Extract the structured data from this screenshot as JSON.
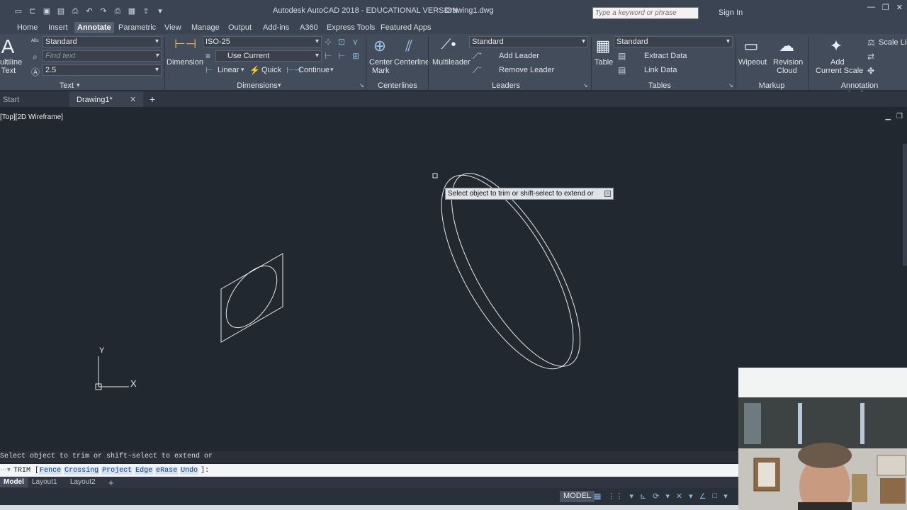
{
  "app": {
    "title": "Autodesk AutoCAD 2018 - EDUCATIONAL VERSION",
    "file": "Drawing1.dwg",
    "search_placeholder": "Type a keyword or phrase",
    "sign_in": "Sign In"
  },
  "menu_tabs": [
    "Home",
    "Insert",
    "Annotate",
    "Parametric",
    "View",
    "Manage",
    "Output",
    "Add-ins",
    "A360",
    "Express Tools",
    "Featured Apps"
  ],
  "active_tab": "Annotate",
  "ribbon": {
    "text_panel": {
      "title": "Text",
      "multiline_label_1": "ultiline",
      "multiline_label_2": "Text",
      "style_value": "Standard",
      "find_placeholder": "Find text",
      "height_value": "2.5"
    },
    "dimensions_panel": {
      "title": "Dimensions",
      "dimension_label": "Dimension",
      "style_value": "ISO-25",
      "layer_value": "Use Current",
      "linear_label": "Linear",
      "quick_label": "Quick",
      "continue_label": "Continue"
    },
    "centerlines_panel": {
      "title": "Centerlines",
      "center_mark_1": "Center",
      "center_mark_2": "Mark",
      "centerline_label": "Centerline"
    },
    "leaders_panel": {
      "title": "Leaders",
      "multileader_label": "Multileader",
      "style_value": "Standard",
      "add_leader": "Add Leader",
      "remove_leader": "Remove Leader"
    },
    "tables_panel": {
      "title": "Tables",
      "table_label": "Table",
      "style_value": "Standard",
      "extract_data": "Extract Data",
      "link_data": "Link Data"
    },
    "markup_panel": {
      "title": "Markup",
      "wipeout": "Wipeout",
      "revision_1": "Revision",
      "revision_2": "Cloud"
    },
    "annotation_scaling_panel": {
      "title": "Annotation Scaling",
      "add_scale_1": "Add",
      "add_scale_2": "Current Scale",
      "scale_list": "Scale List"
    }
  },
  "file_tabs": {
    "start": "Start",
    "drawing": "Drawing1*"
  },
  "viewport": {
    "label": "[Top][2D Wireframe]",
    "ucs_x": "X",
    "ucs_y": "Y"
  },
  "tooltip": {
    "text": "Select object to trim or shift-select to extend or"
  },
  "command": {
    "history": "Select object to trim or shift-select to extend or",
    "name": "TRIM",
    "options": [
      "Fence",
      "Crossing",
      "Project",
      "Edge",
      "eRase",
      "Undo"
    ],
    "suffix": "]:"
  },
  "layout_tabs": [
    "Model",
    "Layout1",
    "Layout2"
  ],
  "status": {
    "model": "MODEL"
  },
  "colors": {
    "canvas_bg": "#212830",
    "ribbon_bg": "#434c5b",
    "linework": "#e8e8e8"
  }
}
